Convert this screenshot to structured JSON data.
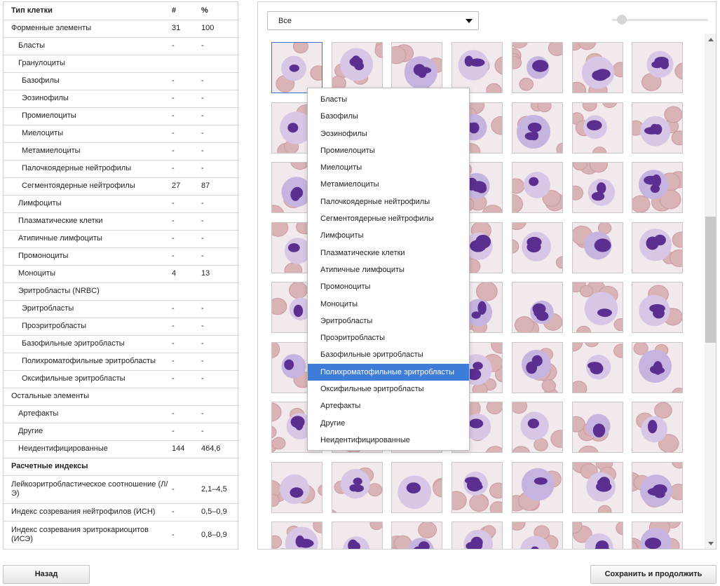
{
  "table": {
    "headers": {
      "name": "Тип клетки",
      "count": "#",
      "percent": "%"
    },
    "rows": [
      {
        "name": "Форменные элементы",
        "count": "31",
        "percent": "100",
        "level": 0
      },
      {
        "name": "Бласты",
        "count": "-",
        "percent": "-",
        "level": 1
      },
      {
        "name": "Гранулоциты",
        "count": "",
        "percent": "",
        "level": 1
      },
      {
        "name": "Базофилы",
        "count": "-",
        "percent": "-",
        "level": 2
      },
      {
        "name": "Эозинофилы",
        "count": "-",
        "percent": "-",
        "level": 2
      },
      {
        "name": "Промиелоциты",
        "count": "-",
        "percent": "-",
        "level": 2
      },
      {
        "name": "Миелоциты",
        "count": "-",
        "percent": "-",
        "level": 2
      },
      {
        "name": "Метамиелоциты",
        "count": "-",
        "percent": "-",
        "level": 2
      },
      {
        "name": "Палочкоядерные нейтрофилы",
        "count": "-",
        "percent": "-",
        "level": 2
      },
      {
        "name": "Сегментоядерные нейтрофилы",
        "count": "27",
        "percent": "87",
        "level": 2
      },
      {
        "name": "Лимфоциты",
        "count": "-",
        "percent": "-",
        "level": 1
      },
      {
        "name": "Плазматические клетки",
        "count": "-",
        "percent": "-",
        "level": 1
      },
      {
        "name": "Атипичные лимфоциты",
        "count": "-",
        "percent": "-",
        "level": 1
      },
      {
        "name": "Промоноциты",
        "count": "-",
        "percent": "-",
        "level": 1
      },
      {
        "name": "Моноциты",
        "count": "4",
        "percent": "13",
        "level": 1
      },
      {
        "name": "Эритробласты (NRBC)",
        "count": "",
        "percent": "",
        "level": 1
      },
      {
        "name": "Эритробласты",
        "count": "-",
        "percent": "-",
        "level": 2
      },
      {
        "name": "Проэритробласты",
        "count": "-",
        "percent": "-",
        "level": 2
      },
      {
        "name": "Базофильные эритробласты",
        "count": "-",
        "percent": "-",
        "level": 2
      },
      {
        "name": "Полихроматофильные эритробласты",
        "count": "-",
        "percent": "-",
        "level": 2
      },
      {
        "name": "Оксифильные эритробласты",
        "count": "-",
        "percent": "-",
        "level": 2
      },
      {
        "name": "Остальные элементы",
        "count": "",
        "percent": "",
        "level": 0
      },
      {
        "name": "Артефакты",
        "count": "-",
        "percent": "-",
        "level": 1
      },
      {
        "name": "Другие",
        "count": "-",
        "percent": "-",
        "level": 1
      },
      {
        "name": "Неидентифицированные",
        "count": "144",
        "percent": "464,6",
        "level": 1
      }
    ],
    "indices_header": "Расчетные индексы",
    "indices": [
      {
        "name": "Лейкоэритробластическое соотношение (Л/Э)",
        "count": "-",
        "percent": "2,1–4,5"
      },
      {
        "name": "Индекс созревания нейтрофилов (ИСН)",
        "count": "-",
        "percent": "0,5–0,9"
      },
      {
        "name": "Индекс созревания эритрокариоцитов (ИСЭ)",
        "count": "-",
        "percent": "0,8–0,9"
      }
    ]
  },
  "filter": {
    "selected": "Все"
  },
  "dropdown": {
    "highlighted_index": 16,
    "options": [
      "Бласты",
      "Базофилы",
      "Эозинофилы",
      "Промиелоциты",
      "Миелоциты",
      "Метамиелоциты",
      "Палочкоядерные нейтрофилы",
      "Сегментоядерные нейтрофилы",
      "Лимфоциты",
      "Плазматические клетки",
      "Атипичные лимфоциты",
      "Промоноциты",
      "Моноциты",
      "Эритробласты",
      "Проэритробласты",
      "Базофильные эритробласты",
      "Полихроматофильные эритробласты",
      "Оксифильные эритробласты",
      "Артефакты",
      "Другие",
      "Неидентифицированные"
    ]
  },
  "gallery": {
    "columns": 7,
    "rows": 9,
    "selected_tile": 0
  },
  "footer": {
    "back_label": "Назад",
    "save_label": "Сохранить и продолжить"
  },
  "colors": {
    "accent": "#3d7dd9",
    "nucleus": "#5a2f8f",
    "cytoplasm": "#d8c6e6",
    "rbc": "#d9b3b6"
  }
}
